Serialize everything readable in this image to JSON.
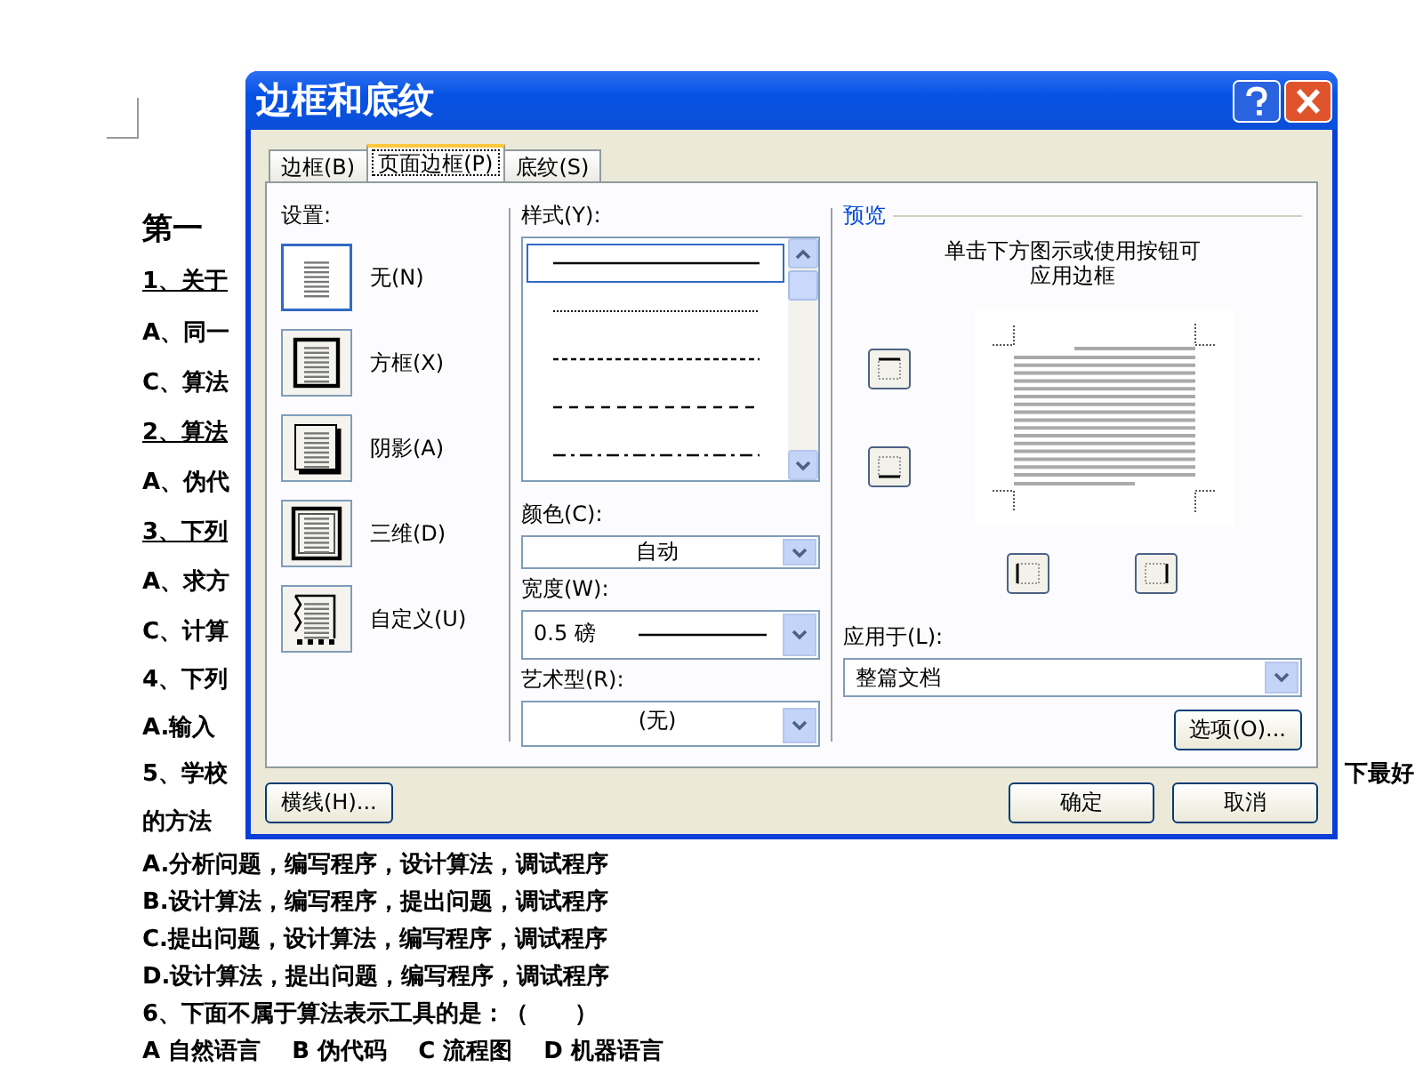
{
  "document": {
    "lines": [
      {
        "text": "第一",
        "kind": "heading"
      },
      {
        "text": "1、关于",
        "kind": "underlined"
      },
      {
        "text": "A、同一",
        "kind": "plain"
      },
      {
        "text": "C、算法",
        "kind": "plain"
      },
      {
        "text": "2、算法",
        "kind": "underlined"
      },
      {
        "text": "A、伪代",
        "kind": "plain"
      },
      {
        "text": "3、下列",
        "kind": "underlined"
      },
      {
        "text": "A、求方",
        "kind": "plain"
      },
      {
        "text": "C、计算",
        "kind": "plain"
      },
      {
        "text": "4、下列",
        "kind": "plain"
      },
      {
        "text": "A.输入",
        "kind": "plain"
      },
      {
        "text": "5、学校",
        "kind": "plain",
        "tail": "下最好"
      },
      {
        "text": "的方法",
        "kind": "plain"
      },
      {
        "text": "A.分析问题，编写程序，设计算法，调试程序",
        "kind": "plain"
      },
      {
        "text": "B.设计算法，编写程序，提出问题，调试程序",
        "kind": "plain"
      },
      {
        "text": "C.提出问题，设计算法，编写程序，调试程序",
        "kind": "plain"
      },
      {
        "text": "D.设计算法，提出问题，编写程序，调试程序",
        "kind": "plain"
      },
      {
        "text": "6、下面不属于算法表示工具的是：（　　）",
        "kind": "plain"
      },
      {
        "text": "A 自然语言　 B 伪代码　 C 流程图　 D 机器语言",
        "kind": "plain"
      }
    ]
  },
  "dialog": {
    "title": "边框和底纹",
    "tabs": [
      {
        "label": "边框(B)",
        "selected": false
      },
      {
        "label": "页面边框(P)",
        "selected": true
      },
      {
        "label": "底纹(S)",
        "selected": false
      }
    ],
    "settings": {
      "label": "设置:",
      "options": [
        {
          "label": "无(N)",
          "kind": "none",
          "selected": true
        },
        {
          "label": "方框(X)",
          "kind": "box",
          "selected": false
        },
        {
          "label": "阴影(A)",
          "kind": "shadow",
          "selected": false
        },
        {
          "label": "三维(D)",
          "kind": "threed",
          "selected": false
        },
        {
          "label": "自定义(U)",
          "kind": "custom",
          "selected": false
        }
      ]
    },
    "style": {
      "label": "样式(Y):",
      "options": [
        {
          "kind": "solid",
          "selected": true
        },
        {
          "kind": "dotted",
          "selected": false
        },
        {
          "kind": "dashed",
          "selected": false
        },
        {
          "kind": "long-dashed",
          "selected": false
        },
        {
          "kind": "dash-dot",
          "selected": false
        }
      ]
    },
    "color": {
      "label": "颜色(C):",
      "value": "自动"
    },
    "width": {
      "label": "宽度(W):",
      "value": "0.5 磅"
    },
    "art": {
      "label": "艺术型(R):",
      "value": "(无)"
    },
    "preview": {
      "title": "预览",
      "hint": "单击下方图示或使用按钮可应用边框"
    },
    "apply_to": {
      "label": "应用于(L):",
      "value": "整篇文档"
    },
    "options_button": "选项(O)...",
    "horizontal_line_button": "横线(H)...",
    "ok_button": "确定",
    "cancel_button": "取消"
  }
}
